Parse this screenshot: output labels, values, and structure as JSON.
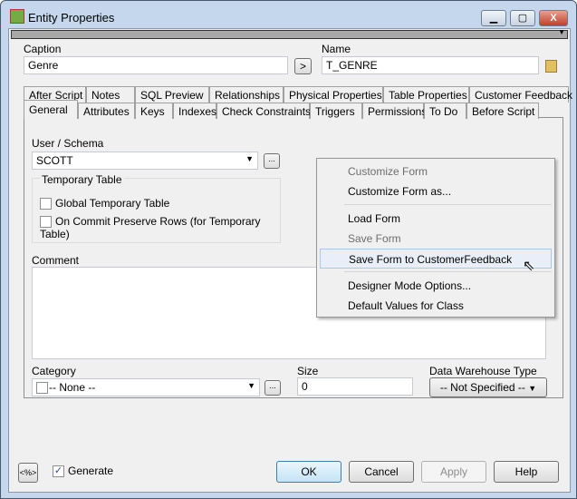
{
  "window": {
    "title": "Entity Properties",
    "minimize": "▁",
    "maximize": "▢",
    "close": "X"
  },
  "caption": {
    "label": "Caption",
    "value": "Genre",
    "arrow": ">"
  },
  "name": {
    "label": "Name",
    "value": "T_GENRE"
  },
  "tabs_row1": [
    "After Script",
    "Notes",
    "SQL Preview",
    "Relationships",
    "Physical Properties",
    "Table Properties",
    "Customer Feedback"
  ],
  "tabs_row2": [
    "General",
    "Attributes",
    "Keys",
    "Indexes",
    "Check Constraints",
    "Triggers",
    "Permissions",
    "To Do",
    "Before Script"
  ],
  "general": {
    "user_schema_label": "User / Schema",
    "user_schema_value": "SCOTT",
    "ellipsis": "...",
    "temp_table_label": "Temporary Table",
    "global_temp": "Global Temporary Table",
    "on_commit": "On Commit Preserve Rows (for Temporary Table)",
    "comment_label": "Comment",
    "category_label": "Category",
    "category_value": "-- None --",
    "size_label": "Size",
    "size_value": "0",
    "dw_label": "Data Warehouse Type",
    "dw_value": "-- Not Specified --"
  },
  "context_menu": [
    "Customize Form",
    "Customize Form as...",
    "Load Form",
    "Save Form",
    "Save Form to CustomerFeedback",
    "Designer Mode Options...",
    "Default Values for Class"
  ],
  "footer": {
    "macro": "<%>",
    "generate": "Generate",
    "ok": "OK",
    "cancel": "Cancel",
    "apply": "Apply",
    "help": "Help"
  }
}
